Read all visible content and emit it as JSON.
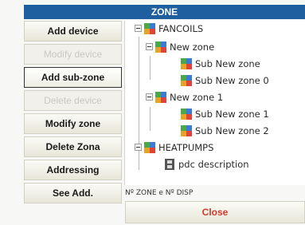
{
  "header": {
    "title": "ZONE"
  },
  "buttons": [
    {
      "label": "Add device",
      "state": "enabled"
    },
    {
      "label": "Modify device",
      "state": "disabled"
    },
    {
      "label": "Add sub-zone",
      "state": "selected"
    },
    {
      "label": "Delete device",
      "state": "disabled"
    },
    {
      "label": "Modify zone",
      "state": "enabled"
    },
    {
      "label": "Delete Zona",
      "state": "enabled"
    },
    {
      "label": "Addressing",
      "state": "enabled"
    },
    {
      "label": "See Add.",
      "state": "enabled"
    }
  ],
  "tree": {
    "nodes": [
      {
        "label": "FANCOILS",
        "icon": "zone-icon",
        "expandable": true
      },
      {
        "label": "New zone",
        "icon": "zone-icon",
        "expandable": true
      },
      {
        "label": "Sub New zone",
        "icon": "zone-icon"
      },
      {
        "label": "Sub New zone 0",
        "icon": "zone-icon"
      },
      {
        "label": "New zone 1",
        "icon": "zone-icon",
        "expandable": true
      },
      {
        "label": "Sub New zone 1",
        "icon": "zone-icon"
      },
      {
        "label": "Sub New zone 2",
        "icon": "zone-icon"
      },
      {
        "label": "HEATPUMPS",
        "icon": "zone-icon",
        "expandable": true
      },
      {
        "label": "pdc description",
        "icon": "device-icon"
      }
    ]
  },
  "status": {
    "text": "Nº ZONE e Nº DISP"
  },
  "close": {
    "label": "Close"
  },
  "colors": {
    "header_bg": "#1f5f9f",
    "close_text": "#d0392b",
    "disabled_text": "#c9c9c1"
  }
}
